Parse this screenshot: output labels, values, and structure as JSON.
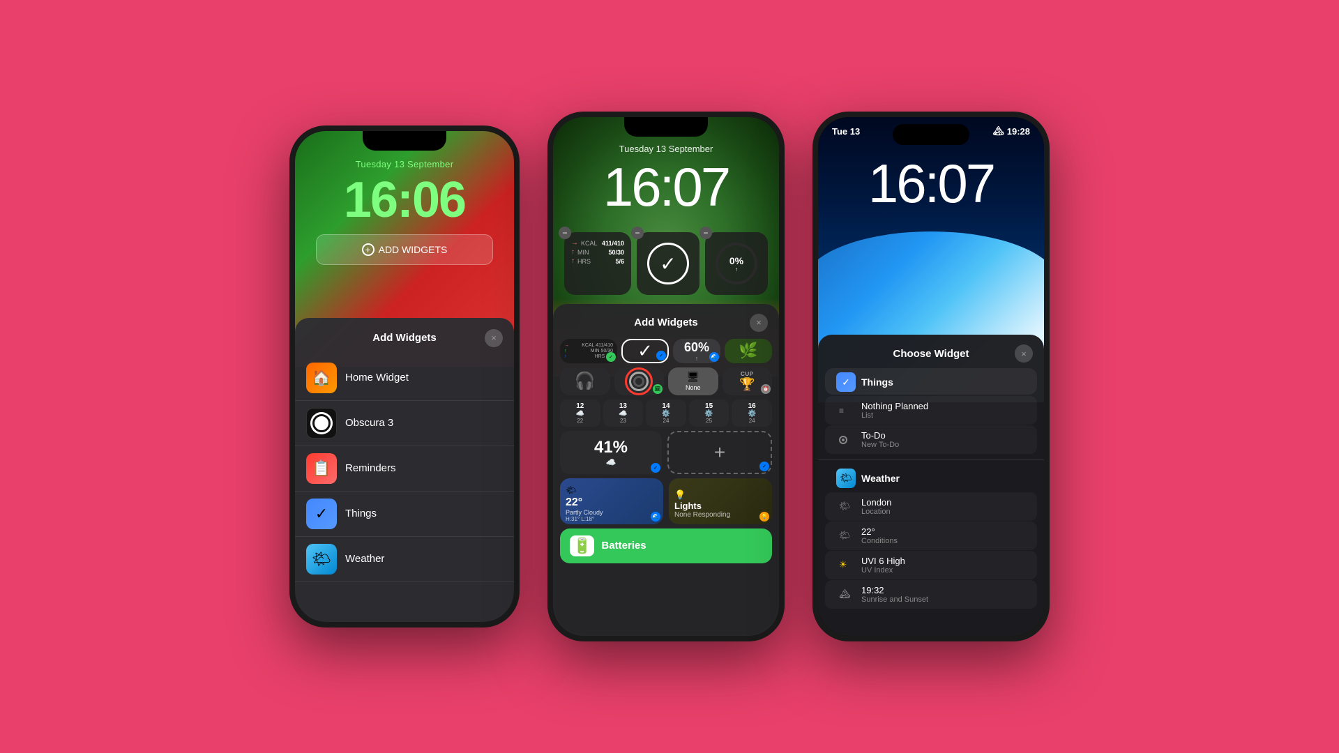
{
  "background": "#e8406a",
  "phone1": {
    "date": "Tuesday 13 September",
    "time": "16:06",
    "add_widget_btn": "ADD WIDGETS",
    "drawer": {
      "title": "Add Widgets",
      "close": "×",
      "items": [
        {
          "name": "Home Widget",
          "icon_type": "home"
        },
        {
          "name": "Obscura 3",
          "icon_type": "obscura"
        },
        {
          "name": "Reminders",
          "icon_type": "reminders"
        },
        {
          "name": "Things",
          "icon_type": "things"
        },
        {
          "name": "Weather",
          "icon_type": "weather"
        }
      ]
    }
  },
  "phone2": {
    "date": "Tuesday 13 September",
    "time": "16:07",
    "drawer": {
      "title": "Add Widgets",
      "close": "×",
      "fitness": {
        "kcal": "411/410",
        "min": "50/30",
        "hrs": "5/6"
      },
      "percent_top": "0%",
      "headphones_icon": "🎧",
      "none_text": "None",
      "cup_text": "CUP",
      "calendar_days": [
        {
          "num": "12",
          "icon": "☁️",
          "sub": "22"
        },
        {
          "num": "13",
          "icon": "☁️",
          "sub": "23"
        },
        {
          "num": "14",
          "icon": "⚙️",
          "sub": "24"
        },
        {
          "num": "15",
          "icon": "⚙️",
          "sub": "25"
        },
        {
          "num": "16",
          "icon": "⚙️",
          "sub": "24"
        }
      ],
      "percent_41": "41%",
      "weather_temp": "22°",
      "weather_desc": "Partly Cloudy",
      "weather_hl": "H:31° L:18°",
      "lights_name": "Lights",
      "lights_status": "None Responding",
      "batteries_label": "Batteries"
    }
  },
  "phone3": {
    "status_date": "Tue 13",
    "status_time": "19:28",
    "time": "16:07",
    "panel": {
      "title": "Choose Widget",
      "close": "×",
      "things_app": "Things",
      "things_items": [
        {
          "title": "Nothing Planned",
          "sub": "List"
        },
        {
          "title": "To-Do",
          "sub": "New To-Do"
        }
      ],
      "weather_app": "Weather",
      "weather_items": [
        {
          "title": "London",
          "sub": "Location"
        },
        {
          "title": "22°",
          "sub": "Conditions"
        },
        {
          "title": "UVI 6 High",
          "sub": "UV Index"
        },
        {
          "title": "19:32",
          "sub": "Sunrise and Sunset"
        }
      ]
    }
  }
}
